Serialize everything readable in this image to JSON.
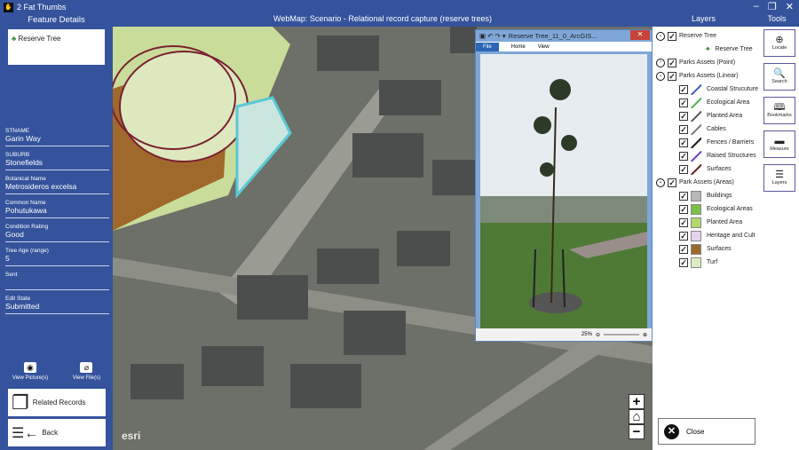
{
  "app": {
    "title": "2 Fat Thumbs",
    "window_controls": [
      "–",
      "❐",
      "✕"
    ]
  },
  "left": {
    "heading": "Feature Details",
    "feature": "Reserve Tree",
    "fields": [
      {
        "label": "STNAME",
        "value": "Garin Way"
      },
      {
        "label": "SUBURB",
        "value": "Stonefields"
      },
      {
        "label": "Botanical Name",
        "value": "Metrosideros excelsa"
      },
      {
        "label": "Common Name",
        "value": "Pohutukawa"
      },
      {
        "label": "Condition Rating",
        "value": "Good"
      },
      {
        "label": "Tree Age (range)",
        "value": "5"
      },
      {
        "label": "Sent",
        "value": ""
      },
      {
        "label": "Edit State",
        "value": "Submitted"
      }
    ],
    "view_pictures": "View Picture(s)",
    "view_files": "View File(s)",
    "related_records": "Related Records",
    "back": "Back"
  },
  "map": {
    "title": "WebMap: Scenario -  Relational record capture (reserve trees)",
    "logo": "esri",
    "zoom_in": "+",
    "home": "⌂",
    "zoom_out": "−"
  },
  "viewer": {
    "title": "Reserve Tree_11_0_ArcGIS...",
    "tabs": [
      "File",
      "Home",
      "View"
    ],
    "zoom": "25%"
  },
  "right": {
    "layers_heading": "Layers",
    "tools_heading": "Tools",
    "groups": [
      {
        "name": "Reserve Tree",
        "expanded": true,
        "items": [
          {
            "name": "Reserve Tree",
            "type": "symbol"
          }
        ]
      },
      {
        "name": "Parks Assets (Point)",
        "expanded": false,
        "items": []
      },
      {
        "name": "Parks Assets (Linear)",
        "expanded": true,
        "items": [
          {
            "name": "Coastal Strucuture",
            "color": "#3b5fc0"
          },
          {
            "name": "Ecological Area",
            "color": "#4caf50"
          },
          {
            "name": "Planted Area",
            "color": "#555555"
          },
          {
            "name": "Cables",
            "color": "#777777"
          },
          {
            "name": "Fences  / Barriers",
            "color": "#111111"
          },
          {
            "name": "Raised Structures",
            "color": "#6a3fc0"
          },
          {
            "name": "Surfaces",
            "color": "#6b1a1a"
          }
        ]
      },
      {
        "name": "Park Assets (Areas)",
        "expanded": true,
        "items": [
          {
            "name": "Buildings",
            "fill": "#b8b8b8"
          },
          {
            "name": "Ecological Areas",
            "fill": "#7cc04a"
          },
          {
            "name": "Planted Area",
            "fill": "#b4d870"
          },
          {
            "name": "Heritage and Cult",
            "fill": "#e6d4ee"
          },
          {
            "name": "Surfaces",
            "fill": "#9c6a2a"
          },
          {
            "name": "Turf",
            "fill": "#dcecc4"
          }
        ]
      }
    ],
    "tools": [
      {
        "label": "Locate",
        "icon": "⊕"
      },
      {
        "label": "Search",
        "icon": "🔍"
      },
      {
        "label": "Bookmarks",
        "icon": "🕮"
      },
      {
        "label": "Measure",
        "icon": "▬"
      },
      {
        "label": "Layers",
        "icon": "☰"
      }
    ],
    "close": "Close"
  }
}
